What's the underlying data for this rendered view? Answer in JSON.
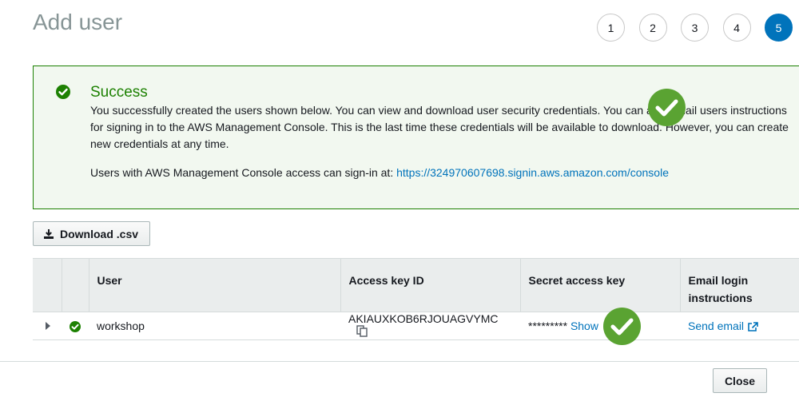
{
  "page": {
    "title": "Add user"
  },
  "steps": [
    "1",
    "2",
    "3",
    "4",
    "5"
  ],
  "active_step": "5",
  "alert": {
    "title": "Success",
    "message": "You successfully created the users shown below. You can view and download user security credentials. You can also email users instructions for signing in to the AWS Management Console. This is the last time these credentials will be available to download. However, you can create new credentials at any time.",
    "signin_prefix": "Users with AWS Management Console access can sign-in at: ",
    "signin_url": "https://324970607698.signin.aws.amazon.com/console"
  },
  "download_button": {
    "label": "Download .csv",
    "icon": "download-icon"
  },
  "table": {
    "headers": {
      "user": "User",
      "access_key_id": "Access key ID",
      "secret_access_key": "Secret access key",
      "email_login": "Email login instructions"
    },
    "rows": [
      {
        "user": "workshop",
        "access_key_id": "AKIAUXKOB6RJOUAGVYMC",
        "secret_masked": "*********",
        "show_label": "Show",
        "send_email_label": "Send email"
      }
    ]
  },
  "footer": {
    "close_label": "Close"
  },
  "colors": {
    "success": "#1d8102",
    "accent": "#0073bb",
    "check_overlay": "#5aa332"
  }
}
